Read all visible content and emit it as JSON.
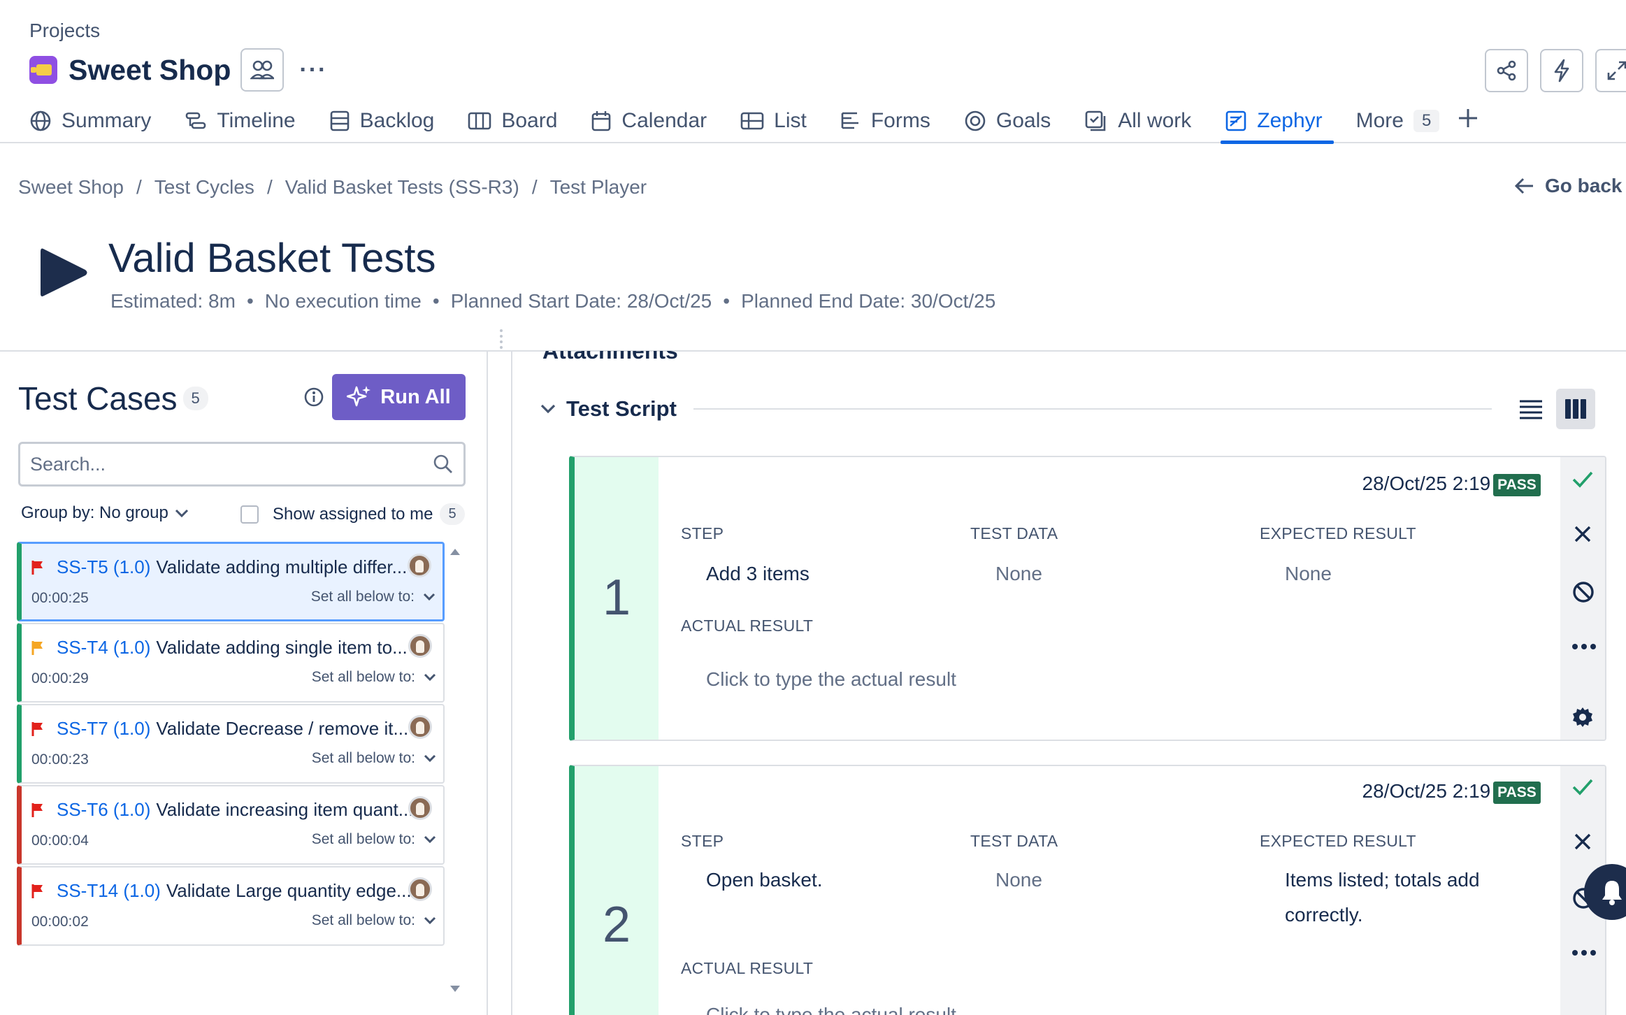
{
  "header": {
    "projects_label": "Projects",
    "project_name": "Sweet Shop"
  },
  "tabs": [
    {
      "label": "Summary",
      "icon": "globe-icon"
    },
    {
      "label": "Timeline",
      "icon": "timeline-icon"
    },
    {
      "label": "Backlog",
      "icon": "backlog-icon"
    },
    {
      "label": "Board",
      "icon": "board-icon"
    },
    {
      "label": "Calendar",
      "icon": "calendar-icon"
    },
    {
      "label": "List",
      "icon": "list-icon"
    },
    {
      "label": "Forms",
      "icon": "forms-icon"
    },
    {
      "label": "Goals",
      "icon": "goals-icon"
    },
    {
      "label": "All work",
      "icon": "all-work-icon"
    },
    {
      "label": "Zephyr",
      "icon": "zephyr-icon",
      "active": true
    },
    {
      "label": "More",
      "count": "5"
    }
  ],
  "breadcrumb": [
    "Sweet Shop",
    "Test Cycles",
    "Valid Basket Tests (SS-R3)",
    "Test Player"
  ],
  "go_back": "Go back",
  "cycle": {
    "title": "Valid Basket Tests",
    "estimated": "Estimated: 8m",
    "execution": "No execution time",
    "planned_start": "Planned Start Date: 28/Oct/25",
    "planned_end": "Planned End Date: 30/Oct/25"
  },
  "left_panel": {
    "title": "Test Cases",
    "count": "5",
    "run_all": "Run All",
    "search_placeholder": "Search...",
    "group_by": "Group by: No group",
    "show_assigned": "Show assigned to me",
    "assigned_count": "5",
    "test_cases": [
      {
        "key": "SS-T5 (1.0)",
        "name": "Validate adding multiple differ...",
        "time": "00:00:25",
        "set_all": "Set all below to:",
        "flag_color": "#e2211b",
        "status_color": "#22a06b",
        "selected": true
      },
      {
        "key": "SS-T4 (1.0)",
        "name": "Validate adding single item to...",
        "time": "00:00:29",
        "set_all": "Set all below to:",
        "flag_color": "#f5a623",
        "status_color": "#22a06b"
      },
      {
        "key": "SS-T7 (1.0)",
        "name": "Validate Decrease / remove it...",
        "time": "00:00:23",
        "set_all": "Set all below to:",
        "flag_color": "#e2211b",
        "status_color": "#22a06b"
      },
      {
        "key": "SS-T6 (1.0)",
        "name": "Validate increasing item quant...",
        "time": "00:00:04",
        "set_all": "Set all below to:",
        "flag_color": "#e2211b",
        "status_color": "#c9372c"
      },
      {
        "key": "SS-T14 (1.0)",
        "name": "Validate Large quantity edge...",
        "time": "00:00:02",
        "set_all": "Set all below to:",
        "flag_color": "#e2211b",
        "status_color": "#c9372c"
      }
    ]
  },
  "right_panel": {
    "attachments_label": "Attachments",
    "test_script_label": "Test Script",
    "step_label": "STEP",
    "test_data_label": "TEST DATA",
    "expected_label": "EXPECTED RESULT",
    "actual_label": "ACTUAL RESULT",
    "actual_placeholder": "Click to type the actual result",
    "steps": [
      {
        "number": "1",
        "date": "28/Oct/25 2:19 PM",
        "status": "PASS",
        "step": "Add 3 items",
        "test_data": "None",
        "expected": "None"
      },
      {
        "number": "2",
        "date": "28/Oct/25 2:19 PM",
        "status": "PASS",
        "step": "Open basket.",
        "test_data": "None",
        "expected": "Items listed; totals add correctly."
      }
    ]
  },
  "colors": {
    "accent": "#0c66e4",
    "run_all": "#6e5dc6",
    "pass": "#216e4e",
    "status_green": "#22a06b",
    "status_red": "#c9372c"
  }
}
